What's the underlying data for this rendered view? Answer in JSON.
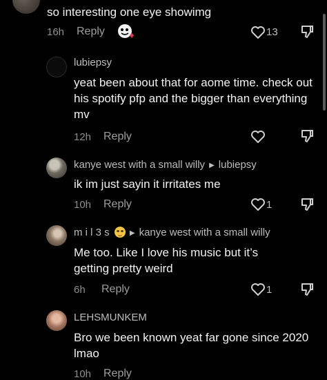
{
  "comments": [
    {
      "username": "",
      "text": "so interesting one eye showimg",
      "time": "16h",
      "reply": "Reply",
      "likes": "13"
    },
    {
      "username": "lubiepsy",
      "text": "yeat been about that for aome time. check out his spotify pfp and the bigger than everything mv",
      "time": "12h",
      "reply": "Reply",
      "likes": ""
    },
    {
      "username": "kanye west with a small willy",
      "reply_to": "lubiepsy",
      "text": "ik im just sayin it irritates me",
      "time": "10h",
      "reply": "Reply",
      "likes": "1"
    },
    {
      "username": "m i l 3 s",
      "reply_to": "kanye west with a small willy",
      "text": "Me too. Like I love his music but it’s getting pretty weird",
      "time": "6h",
      "reply": "Reply",
      "likes": "1"
    },
    {
      "username": "LEHSMUNKEM",
      "text": "Bro we been known yeat far gone since 2020 lmao",
      "time": "10h",
      "reply": "Reply",
      "likes": ""
    }
  ],
  "icons": {
    "like": "heart-icon",
    "dislike": "thumbs-down-icon",
    "sticker": "ghost-sticker-icon",
    "emoji": "smiling-face-emoji"
  }
}
